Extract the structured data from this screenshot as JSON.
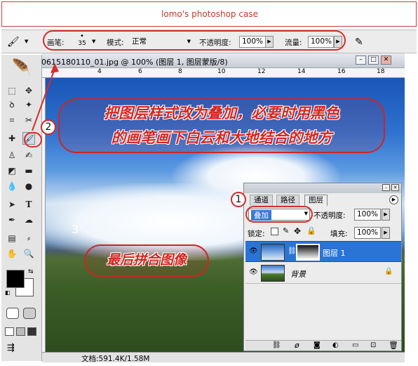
{
  "banner": {
    "text": "lomo's photoshop case"
  },
  "options_bar": {
    "brush_label": "画笔:",
    "brush_size": "35",
    "mode_label": "模式:",
    "mode_value": "正常",
    "opacity_label": "不透明度:",
    "opacity_value": "100%",
    "flow_label": "流量:",
    "flow_value": "100%"
  },
  "document": {
    "title": "0615180110_01.jpg @ 100% (图层 1, 图层蒙版/8)",
    "ruler_numbers": [
      "4",
      "6",
      "8",
      "10",
      "12",
      "14",
      "16",
      "18"
    ],
    "status": "文档:591.4K/1.58M"
  },
  "annotations": {
    "step2_text_line1": "把图层样式改为叠加，必要时用黑色",
    "step2_text_line2": "的画笔画下白云和大地结合的地方",
    "step3_text": "最后拼合图像",
    "num1": "1",
    "num2": "2",
    "num3": "3"
  },
  "layers_panel": {
    "tabs": [
      "通道",
      "路径",
      "图层"
    ],
    "blend_mode": "叠加",
    "opacity_label": "不透明度:",
    "opacity_value": "100%",
    "lock_label": "锁定:",
    "fill_label": "填充:",
    "fill_value": "100%",
    "layers": [
      {
        "name": "图层 1"
      },
      {
        "name": "背景"
      }
    ]
  },
  "colors": {
    "annotation_red": "#d62c2c",
    "selected_layer": "#2a74d6"
  }
}
